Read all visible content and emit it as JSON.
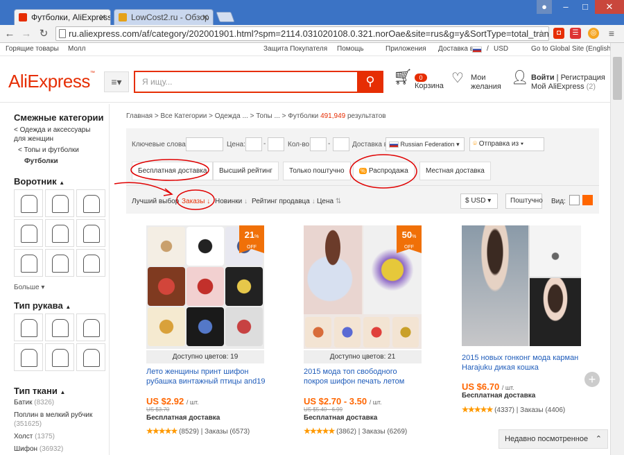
{
  "browser": {
    "tabs": [
      {
        "label": "Футболки, AliExpress"
      },
      {
        "label": "LowCost2.ru - Обзор"
      }
    ],
    "url": "ru.aliexpress.com/af/category/202001901.html?spm=2114.031020108.0.321.norOae&site=rus&g=y&SortType=total_tranpro"
  },
  "topnav": {
    "left": [
      "Горящие товары",
      "Молл"
    ],
    "right": [
      "Защита Покупателя",
      "Помощь",
      "Приложения",
      "Доставка в",
      "USD",
      "Go to Global Site (English)"
    ]
  },
  "header": {
    "logo": "AliExpress",
    "logo_tm": "™",
    "search_placeholder": "Я ищу...",
    "cart_count": "0",
    "cart_label": "Корзина",
    "wishlist_line1": "Мои",
    "wishlist_line2": "желания",
    "signin": "Войти",
    "register": "Регистрация",
    "my_ali": "Мой AliExpress",
    "my_ali_count": "(2)"
  },
  "sidebar": {
    "related_title": "Смежные категории",
    "related_links": [
      "< Одежда и аксессуары для женщин",
      "< Топы и футболки",
      "Футболки"
    ],
    "collar_title": "Воротник",
    "more": "Больше",
    "sleeve_title": "Тип рукава",
    "fabric_title": "Тип ткани",
    "fabrics": [
      {
        "name": "Батик",
        "count": "(8326)"
      },
      {
        "name": "Поплин в мелкий рубчик",
        "count": "(351625)"
      },
      {
        "name": "Холст",
        "count": "(1375)"
      },
      {
        "name": "Шифон",
        "count": "(36932)"
      }
    ]
  },
  "breadcrumb": {
    "path": "Главная > Все Категории > Одежда ... > Топы ... > Футболки",
    "count": "491,949",
    "suffix": "результатов"
  },
  "filters": {
    "keywords": "Ключевые слова:",
    "price": "Цена:",
    "qty": "Кол-во:",
    "ship_to": "Доставка в",
    "country": "Russian Federation",
    "ship_from": "Отправка из",
    "chips": [
      "Бесплатная доставка",
      "Высший рейтинг",
      "Только поштучно",
      "Распродажа",
      "Местная доставка"
    ],
    "sort": [
      "Лучший выбор",
      "Заказы",
      "Новинки",
      "Рейтинг продавца",
      "Цена"
    ],
    "currency": "$ USD",
    "unit": "Поштучно",
    "view": "Вид:"
  },
  "products": [
    {
      "discount": "21",
      "colors": "Доступно цветов: 19",
      "title": "Лето женщины принт шифон рубашка винтажный птицы and19",
      "price": "US $2.92",
      "unit": "/ шт.",
      "old": "US $3.70",
      "shipping": "Бесплатная доставка",
      "reviews": "(8529)",
      "orders": "Заказы (6573)"
    },
    {
      "discount": "50",
      "colors": "Доступно цветов: 21",
      "title": "2015 мода топ свободного покроя шифон печать летом",
      "price": "US $2.70 - 3.50",
      "unit": "/ шт.",
      "old": "US $5.40 - 6.99",
      "shipping": "Бесплатная доставка",
      "reviews": "(3862)",
      "orders": "Заказы (6269)"
    },
    {
      "title": "2015 новых гонконг мода карман Harajuku дикая кошка",
      "price": "US $6.70",
      "unit": "/ шт.",
      "shipping": "Бесплатная доставка",
      "reviews": "(4337)",
      "orders": "Заказы (4406)"
    }
  ],
  "recent": "Недавно посмотренное",
  "colors": {
    "brand": "#e62e04",
    "accent": "#f60",
    "link": "#1f5cba",
    "annotation": "#e00000"
  }
}
